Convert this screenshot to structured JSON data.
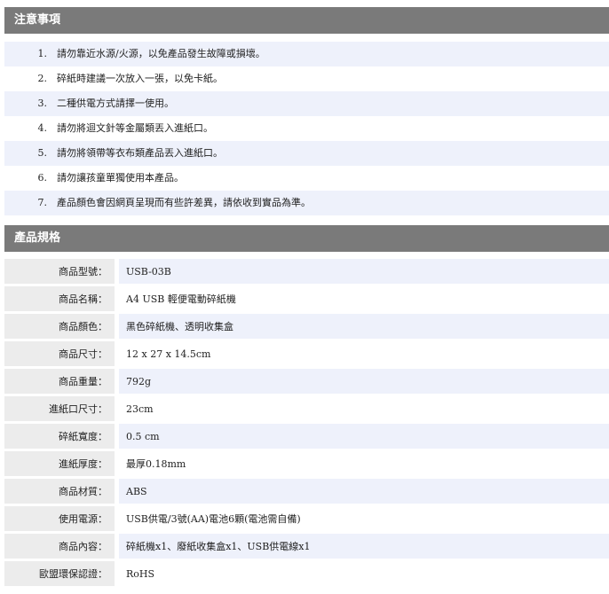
{
  "notes": {
    "title": "注意事項",
    "items": [
      {
        "num": "1.",
        "text": "請勿靠近水源/火源，以免產品發生故障或損壞。"
      },
      {
        "num": "2.",
        "text": "碎紙時建議一次放入一張，以免卡紙。"
      },
      {
        "num": "3.",
        "text": "二種供電方式請擇一使用。"
      },
      {
        "num": "4.",
        "text": "請勿將迴文針等金屬類丟入進紙口。"
      },
      {
        "num": "5.",
        "text": "請勿將領帶等衣布類產品丟入進紙口。"
      },
      {
        "num": "6.",
        "text": "請勿讓孩童單獨使用本產品。"
      },
      {
        "num": "7.",
        "text": "產品顏色會因網頁呈現而有些許差異，請依收到實品為準。"
      }
    ]
  },
  "specs": {
    "title": "產品規格",
    "rows": [
      {
        "label": "商品型號：",
        "value": "USB-03B"
      },
      {
        "label": "商品名稱：",
        "value": "A4 USB 輕便電動碎紙機"
      },
      {
        "label": "商品顏色：",
        "value": "黑色碎紙機、透明收集盒"
      },
      {
        "label": "商品尺寸：",
        "value": "12 x 27 x 14.5cm"
      },
      {
        "label": "商品重量：",
        "value": "792g"
      },
      {
        "label": "進紙口尺寸：",
        "value": "23cm"
      },
      {
        "label": "碎紙寬度：",
        "value": "0.5 cm"
      },
      {
        "label": "進紙厚度：",
        "value": "最厚0.18mm"
      },
      {
        "label": "商品材質：",
        "value": "ABS"
      },
      {
        "label": "使用電源：",
        "value": "USB供電/3號(AA)電池6顆(電池需自備)"
      },
      {
        "label": "商品內容：",
        "value": "碎紙機x1、廢紙收集盒x1、USB供電線x1"
      },
      {
        "label": "歐盟環保認證：",
        "value": "RoHS"
      }
    ]
  }
}
